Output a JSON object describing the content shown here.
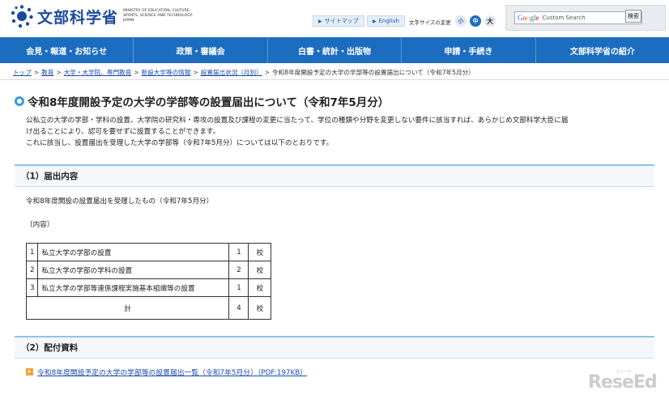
{
  "header": {
    "logo_text": "文部科学省",
    "logo_sub": "MINISTRY OF EDUCATION, CULTURE, SPORTS, SCIENCE AND TECHNOLOGY-JAPAN",
    "sitemap": "サイトマップ",
    "english": "English",
    "font_size_label": "文字サイズの変更",
    "font_small": "小",
    "font_medium": "中",
    "font_large": "大",
    "search_logo": "Google",
    "search_placeholder": "Custom Search",
    "search_button": "検索"
  },
  "nav": {
    "items": [
      "会見・報道・お知らせ",
      "政策・審議会",
      "白書・統計・出版物",
      "申請・手続き",
      "文部科学省の紹介"
    ]
  },
  "breadcrumb": {
    "items": [
      "トップ",
      "教育",
      "大学・大学院、専門教育",
      "新設大学等の情報",
      "設置届出状況（月別）"
    ],
    "current": "令和8年度開設予定の大学の学部等の設置届出について（令和7年5月分）",
    "separator": ">"
  },
  "page": {
    "title": "令和8年度開設予定の大学の学部等の設置届出について（令和7年5月分）",
    "intro1": "公私立の大学の学部・学科の設置、大学院の研究科・専攻の設置及び課程の変更に当たって、学位の種類や分野を変更しない要件に該当すれば、あらかじめ文部科学大臣に届",
    "intro2": "け出ることにより、認可を要せずに設置することができます。",
    "intro3": "これに該当し、設置届出を受理した大学の学部等（令和7年5月分）については以下のとおりです。"
  },
  "section1": {
    "heading": "（1）届出内容",
    "lead": "令和8年度開設の設置届出を受理したもの（令和7年5月分）",
    "content_label": "〔内容〕",
    "rows": [
      {
        "no": "1",
        "desc": "私立大学の学部の設置",
        "count": "1",
        "unit": "校"
      },
      {
        "no": "2",
        "desc": "私立大学の学部の学科の設置",
        "count": "2",
        "unit": "校"
      },
      {
        "no": "3",
        "desc": "私立大学の学部等連係課程実施基本組織等の設置",
        "count": "1",
        "unit": "校"
      }
    ],
    "total_label": "計",
    "total_count": "4",
    "total_unit": "校"
  },
  "section2": {
    "heading": "（2）配付資料",
    "doc_link": "令和8年度開設予定の大学の学部等の設置届出一覧（令和7年5月分）（PDF:197KB）"
  },
  "watermark": {
    "text": "ReseEd",
    "sub": "リシード"
  },
  "colors": {
    "nav_bg": "#1c6dc0",
    "link": "#1a4ab0",
    "section_border": "#8ec3e6",
    "doc_icon": "#f2a43a"
  }
}
